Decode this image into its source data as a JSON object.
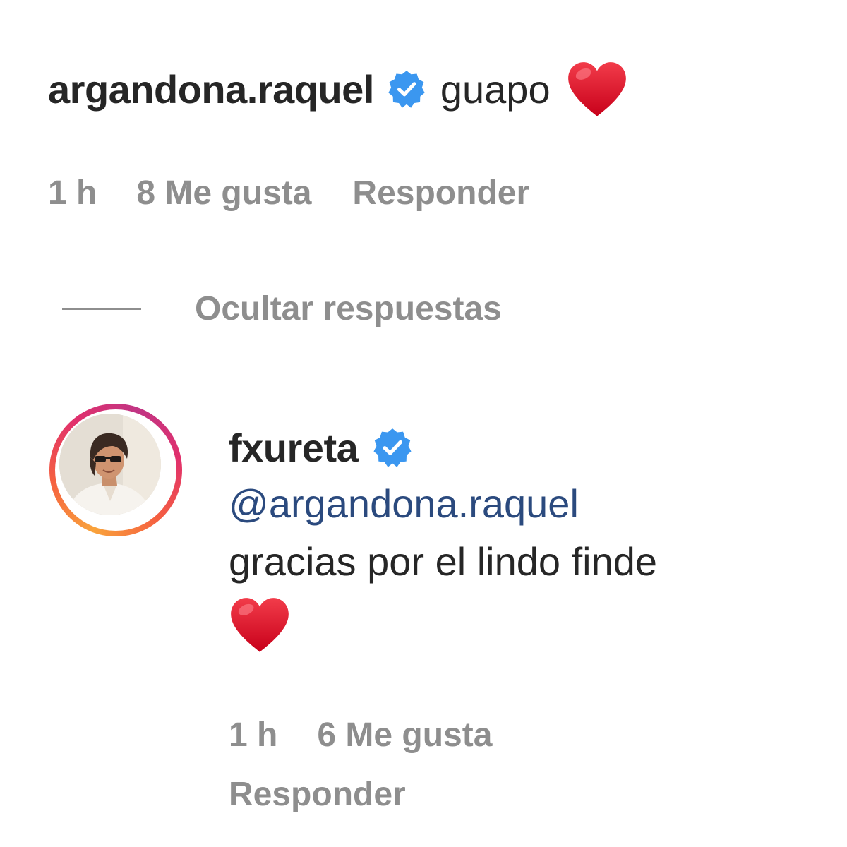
{
  "comment": {
    "username": "argandona.raquel",
    "verified": true,
    "text": "guapo",
    "emoji": "heart",
    "time": "1 h",
    "likes": "8 Me gusta",
    "reply_label": "Responder"
  },
  "replies_toggle": {
    "label": "Ocultar respuestas"
  },
  "reply": {
    "username": "fxureta",
    "verified": true,
    "mention": "@argandona.raquel",
    "text": "gracias por el lindo finde",
    "emoji": "heart",
    "time": "1 h",
    "likes": "6 Me gusta",
    "reply_label": "Responder",
    "avatar_has_story_ring": true
  },
  "colors": {
    "text": "#262626",
    "secondary": "#8e8e8e",
    "verified_blue": "#3897f0",
    "mention": "#2b4a7e",
    "heart": "#e0102a"
  },
  "icons": {
    "verified": "verified-badge-icon",
    "heart": "red-heart-emoji"
  }
}
